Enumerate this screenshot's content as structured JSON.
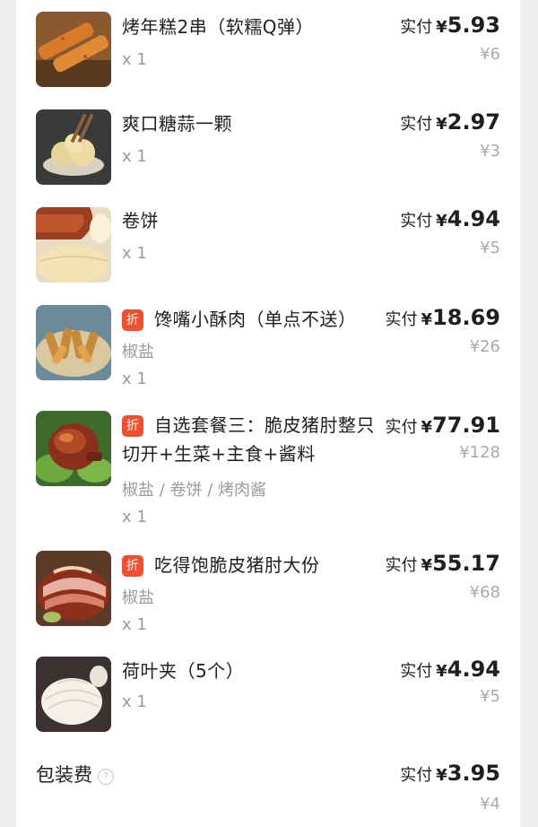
{
  "currency_symbol": "¥",
  "items": [
    {
      "name": "烤年糕2串（软糯Q弹）",
      "paid_label": "实付",
      "paid": "5.93",
      "original": "¥6",
      "qty": "x 1",
      "discount": false,
      "icon": "grilled-rice-cake-image"
    },
    {
      "name": "爽口糖蒜一颗",
      "paid_label": "实付",
      "paid": "2.97",
      "original": "¥3",
      "qty": "x 1",
      "discount": false,
      "icon": "garlic-image"
    },
    {
      "name": "卷饼",
      "paid_label": "实付",
      "paid": "4.94",
      "original": "¥5",
      "qty": "x 1",
      "discount": false,
      "icon": "pancake-image"
    },
    {
      "name": "馋嘴小酥肉（单点不送）",
      "discount_label": "折",
      "paid_label": "实付",
      "paid": "18.69",
      "original": "¥26",
      "spec": "椒盐",
      "qty": "x 1",
      "discount": true,
      "icon": "crispy-pork-image"
    },
    {
      "name": "自选套餐三：脆皮猪肘整只切开+生菜+主食+酱料",
      "discount_label": "折",
      "paid_label": "实付",
      "paid": "77.91",
      "original": "¥128",
      "spec": "椒盐 / 卷饼 / 烤肉酱",
      "qty": "x 1",
      "discount": true,
      "icon": "pork-knuckle-image"
    },
    {
      "name": "吃得饱脆皮猪肘大份",
      "discount_label": "折",
      "paid_label": "实付",
      "paid": "55.17",
      "original": "¥68",
      "spec": "椒盐",
      "qty": "x 1",
      "discount": true,
      "icon": "sliced-pork-image"
    },
    {
      "name": "荷叶夹（5个）",
      "paid_label": "实付",
      "paid": "4.94",
      "original": "¥5",
      "qty": "x 1",
      "discount": false,
      "icon": "steamed-bun-image"
    }
  ],
  "packaging": {
    "label": "包装费",
    "help_icon": "question-circle-icon",
    "help_glyph": "?",
    "paid_label": "实付",
    "paid": "3.95",
    "original": "¥4"
  },
  "colors": {
    "discount_badge": "#f0502f",
    "muted_text": "#9a9a9a",
    "background": "#efefef"
  }
}
